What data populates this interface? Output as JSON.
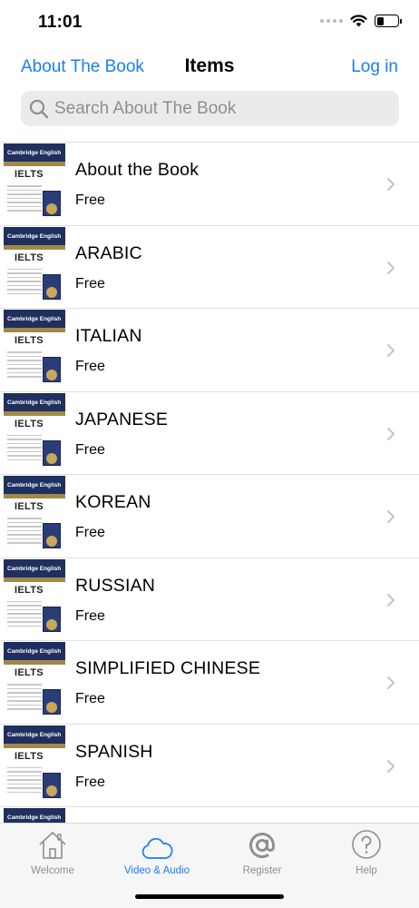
{
  "status": {
    "time": "11:01",
    "battery_level": 0.35
  },
  "nav": {
    "back_label": "About The Book",
    "title": "Items",
    "right_label": "Log in"
  },
  "search": {
    "placeholder": "Search About The Book",
    "value": ""
  },
  "items": [
    {
      "title": "About the Book",
      "subtitle": "Free"
    },
    {
      "title": "ARABIC",
      "subtitle": "Free"
    },
    {
      "title": "ITALIAN",
      "subtitle": "Free"
    },
    {
      "title": "JAPANESE",
      "subtitle": "Free"
    },
    {
      "title": "KOREAN",
      "subtitle": "Free"
    },
    {
      "title": "RUSSIAN",
      "subtitle": "Free"
    },
    {
      "title": "SIMPLIFIED CHINESE",
      "subtitle": "Free"
    },
    {
      "title": "SPANISH",
      "subtitle": "Free"
    },
    {
      "title": "",
      "subtitle": ""
    }
  ],
  "thumbnail": {
    "brand": "Cambridge English",
    "title": "IELTS"
  },
  "tabs": [
    {
      "label": "Welcome",
      "icon": "house-icon",
      "active": false
    },
    {
      "label": "Video & Audio",
      "icon": "cloud-icon",
      "active": true
    },
    {
      "label": "Register",
      "icon": "at-sign-icon",
      "active": false
    },
    {
      "label": "Help",
      "icon": "help-circle-icon",
      "active": false
    }
  ],
  "colors": {
    "accent": "#1a7ef1",
    "inactive": "#8e8e93",
    "thumb_band": "#1f2f5e"
  }
}
